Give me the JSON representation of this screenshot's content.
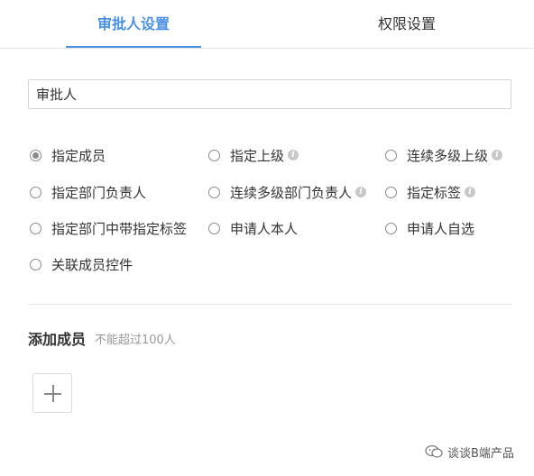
{
  "tabs": [
    {
      "label": "审批人设置",
      "active": true
    },
    {
      "label": "权限设置",
      "active": false
    }
  ],
  "name_field": {
    "value": "审批人"
  },
  "options": [
    {
      "label": "指定成员",
      "checked": true,
      "has_info": false
    },
    {
      "label": "指定上级",
      "checked": false,
      "has_info": true
    },
    {
      "label": "连续多级上级",
      "checked": false,
      "has_info": true
    },
    {
      "label": "指定部门负责人",
      "checked": false,
      "has_info": false
    },
    {
      "label": "连续多级部门负责人",
      "checked": false,
      "has_info": true
    },
    {
      "label": "指定标签",
      "checked": false,
      "has_info": true
    },
    {
      "label": "指定部门中带指定标签",
      "checked": false,
      "has_info": false
    },
    {
      "label": "申请人本人",
      "checked": false,
      "has_info": false
    },
    {
      "label": "申请人自选",
      "checked": false,
      "has_info": false
    },
    {
      "label": "关联成员控件",
      "checked": false,
      "has_info": false
    }
  ],
  "info_glyph": "i",
  "add_members": {
    "title": "添加成员",
    "hint": "不能超过100人"
  },
  "watermark": {
    "text": "谈谈B端产品"
  },
  "colors": {
    "accent": "#4a90e2",
    "text": "#333333",
    "muted": "#999999"
  }
}
